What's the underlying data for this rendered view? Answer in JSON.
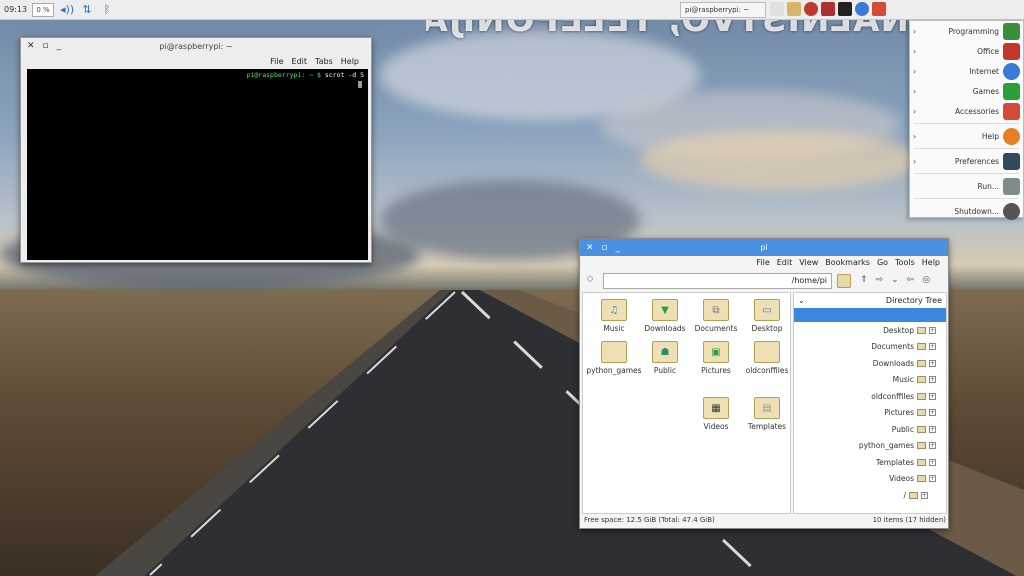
{
  "watermark": "RAČUNALNIŠTVO, TELEFONIJA",
  "panel": {
    "clock": "09:13",
    "cpu": "0 %",
    "taskbar_item": "pi@raspberrypi: ~"
  },
  "terminal": {
    "title": "pi@raspberrypi: ~",
    "menu": [
      "File",
      "Edit",
      "Tabs",
      "Help"
    ],
    "prompt_user": "pi@raspberrypi:",
    "prompt_path": "~ $",
    "command": "scrot -d 5"
  },
  "main_menu": {
    "items": [
      {
        "label": "Programming",
        "icon": "programming-icon",
        "color": "#3a8f3a"
      },
      {
        "label": "Office",
        "icon": "office-icon",
        "color": "#c0392b"
      },
      {
        "label": "Internet",
        "icon": "globe-icon",
        "color": "#3a7bd5"
      },
      {
        "label": "Games",
        "icon": "games-icon",
        "color": "#2e9e3b"
      },
      {
        "label": "Accessories",
        "icon": "accessories-icon",
        "color": "#d44b3a"
      },
      {
        "label": "Help",
        "icon": "help-icon",
        "color": "#e67e22"
      },
      {
        "label": "Preferences",
        "icon": "preferences-icon",
        "color": "#34495e"
      },
      {
        "label": "Run...",
        "icon": "run-icon",
        "color": "#7f8c8d"
      },
      {
        "label": "Shutdown...",
        "icon": "shutdown-icon",
        "color": "#555555"
      }
    ]
  },
  "file_manager": {
    "title": "pi",
    "menu": [
      "File",
      "Edit",
      "View",
      "Bookmarks",
      "Go",
      "Tools",
      "Help"
    ],
    "address": "/home/pi",
    "side_header": "Directory Tree",
    "tree": [
      "Desktop",
      "Documents",
      "Downloads",
      "Music",
      "oldconffiles",
      "Pictures",
      "Public",
      "python_games",
      "Templates",
      "Videos",
      "/"
    ],
    "icons": [
      {
        "name": "Desktop",
        "glyph": "▭"
      },
      {
        "name": "Documents",
        "glyph": "⧉"
      },
      {
        "name": "Downloads",
        "glyph": "▼"
      },
      {
        "name": "Music",
        "glyph": "♫"
      },
      {
        "name": "oldconffiles",
        "glyph": ""
      },
      {
        "name": "Pictures",
        "glyph": "▣"
      },
      {
        "name": "Public",
        "glyph": "☗"
      },
      {
        "name": "python_games",
        "glyph": ""
      },
      {
        "name": "Templates",
        "glyph": "▤"
      },
      {
        "name": "Videos",
        "glyph": "▦"
      }
    ],
    "status_left": "Free space: 12.5 GiB (Total: 47.4 GiB)",
    "status_right": "10 items (17 hidden)"
  }
}
